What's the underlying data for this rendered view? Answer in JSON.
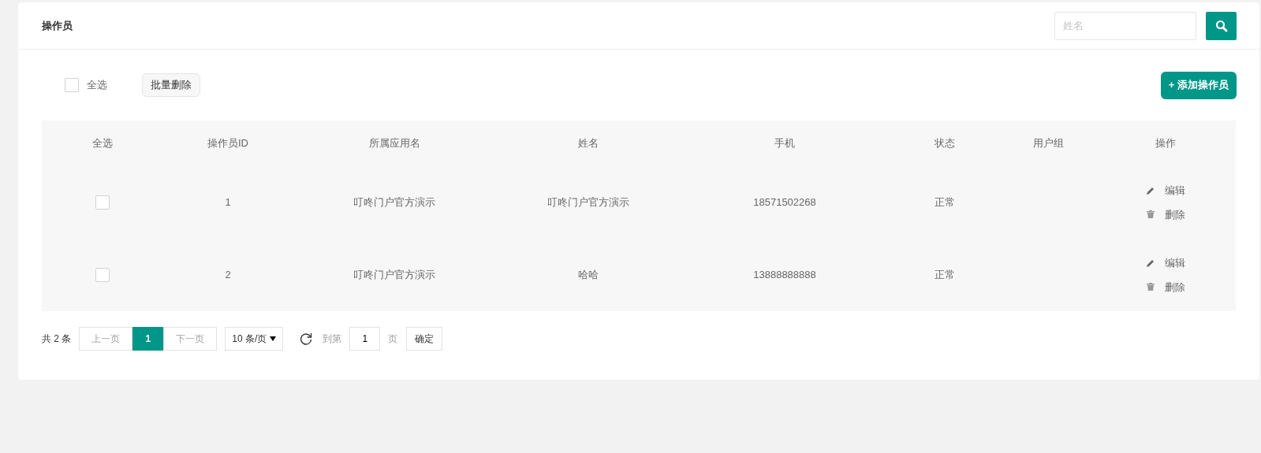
{
  "header": {
    "title": "操作员",
    "search": {
      "placeholder": "姓名"
    }
  },
  "toolbar": {
    "select_all": {
      "label": "全选",
      "checked": false
    },
    "batch_delete": "批量删除",
    "add_button": "+ 添加操作员"
  },
  "table": {
    "columns": [
      "全选",
      "操作员ID",
      "所属应用名",
      "姓名",
      "手机",
      "状态",
      "用户组",
      "操作"
    ],
    "rows": [
      {
        "checked": false,
        "id": "1",
        "app": "叮咚门户官方演示",
        "name": "叮咚门户官方演示",
        "phone": "18571502268",
        "status": "正常",
        "group": "",
        "actions": [
          "编辑",
          "删除"
        ]
      },
      {
        "checked": false,
        "id": "2",
        "app": "叮咚门户官方演示",
        "name": "哈哈",
        "phone": "13888888888",
        "status": "正常",
        "group": "",
        "actions": [
          "编辑",
          "删除"
        ]
      }
    ]
  },
  "pagination": {
    "total": "共 2 条",
    "prev": {
      "label": "上一页",
      "disabled": true
    },
    "pages": [
      {
        "label": "1",
        "selected": true
      }
    ],
    "next": {
      "label": "下一页",
      "disabled": true
    },
    "page_size": "10 条/页",
    "goto_label": "到第",
    "goto_value": "1",
    "page_unit": "页",
    "confirm": "确定"
  }
}
